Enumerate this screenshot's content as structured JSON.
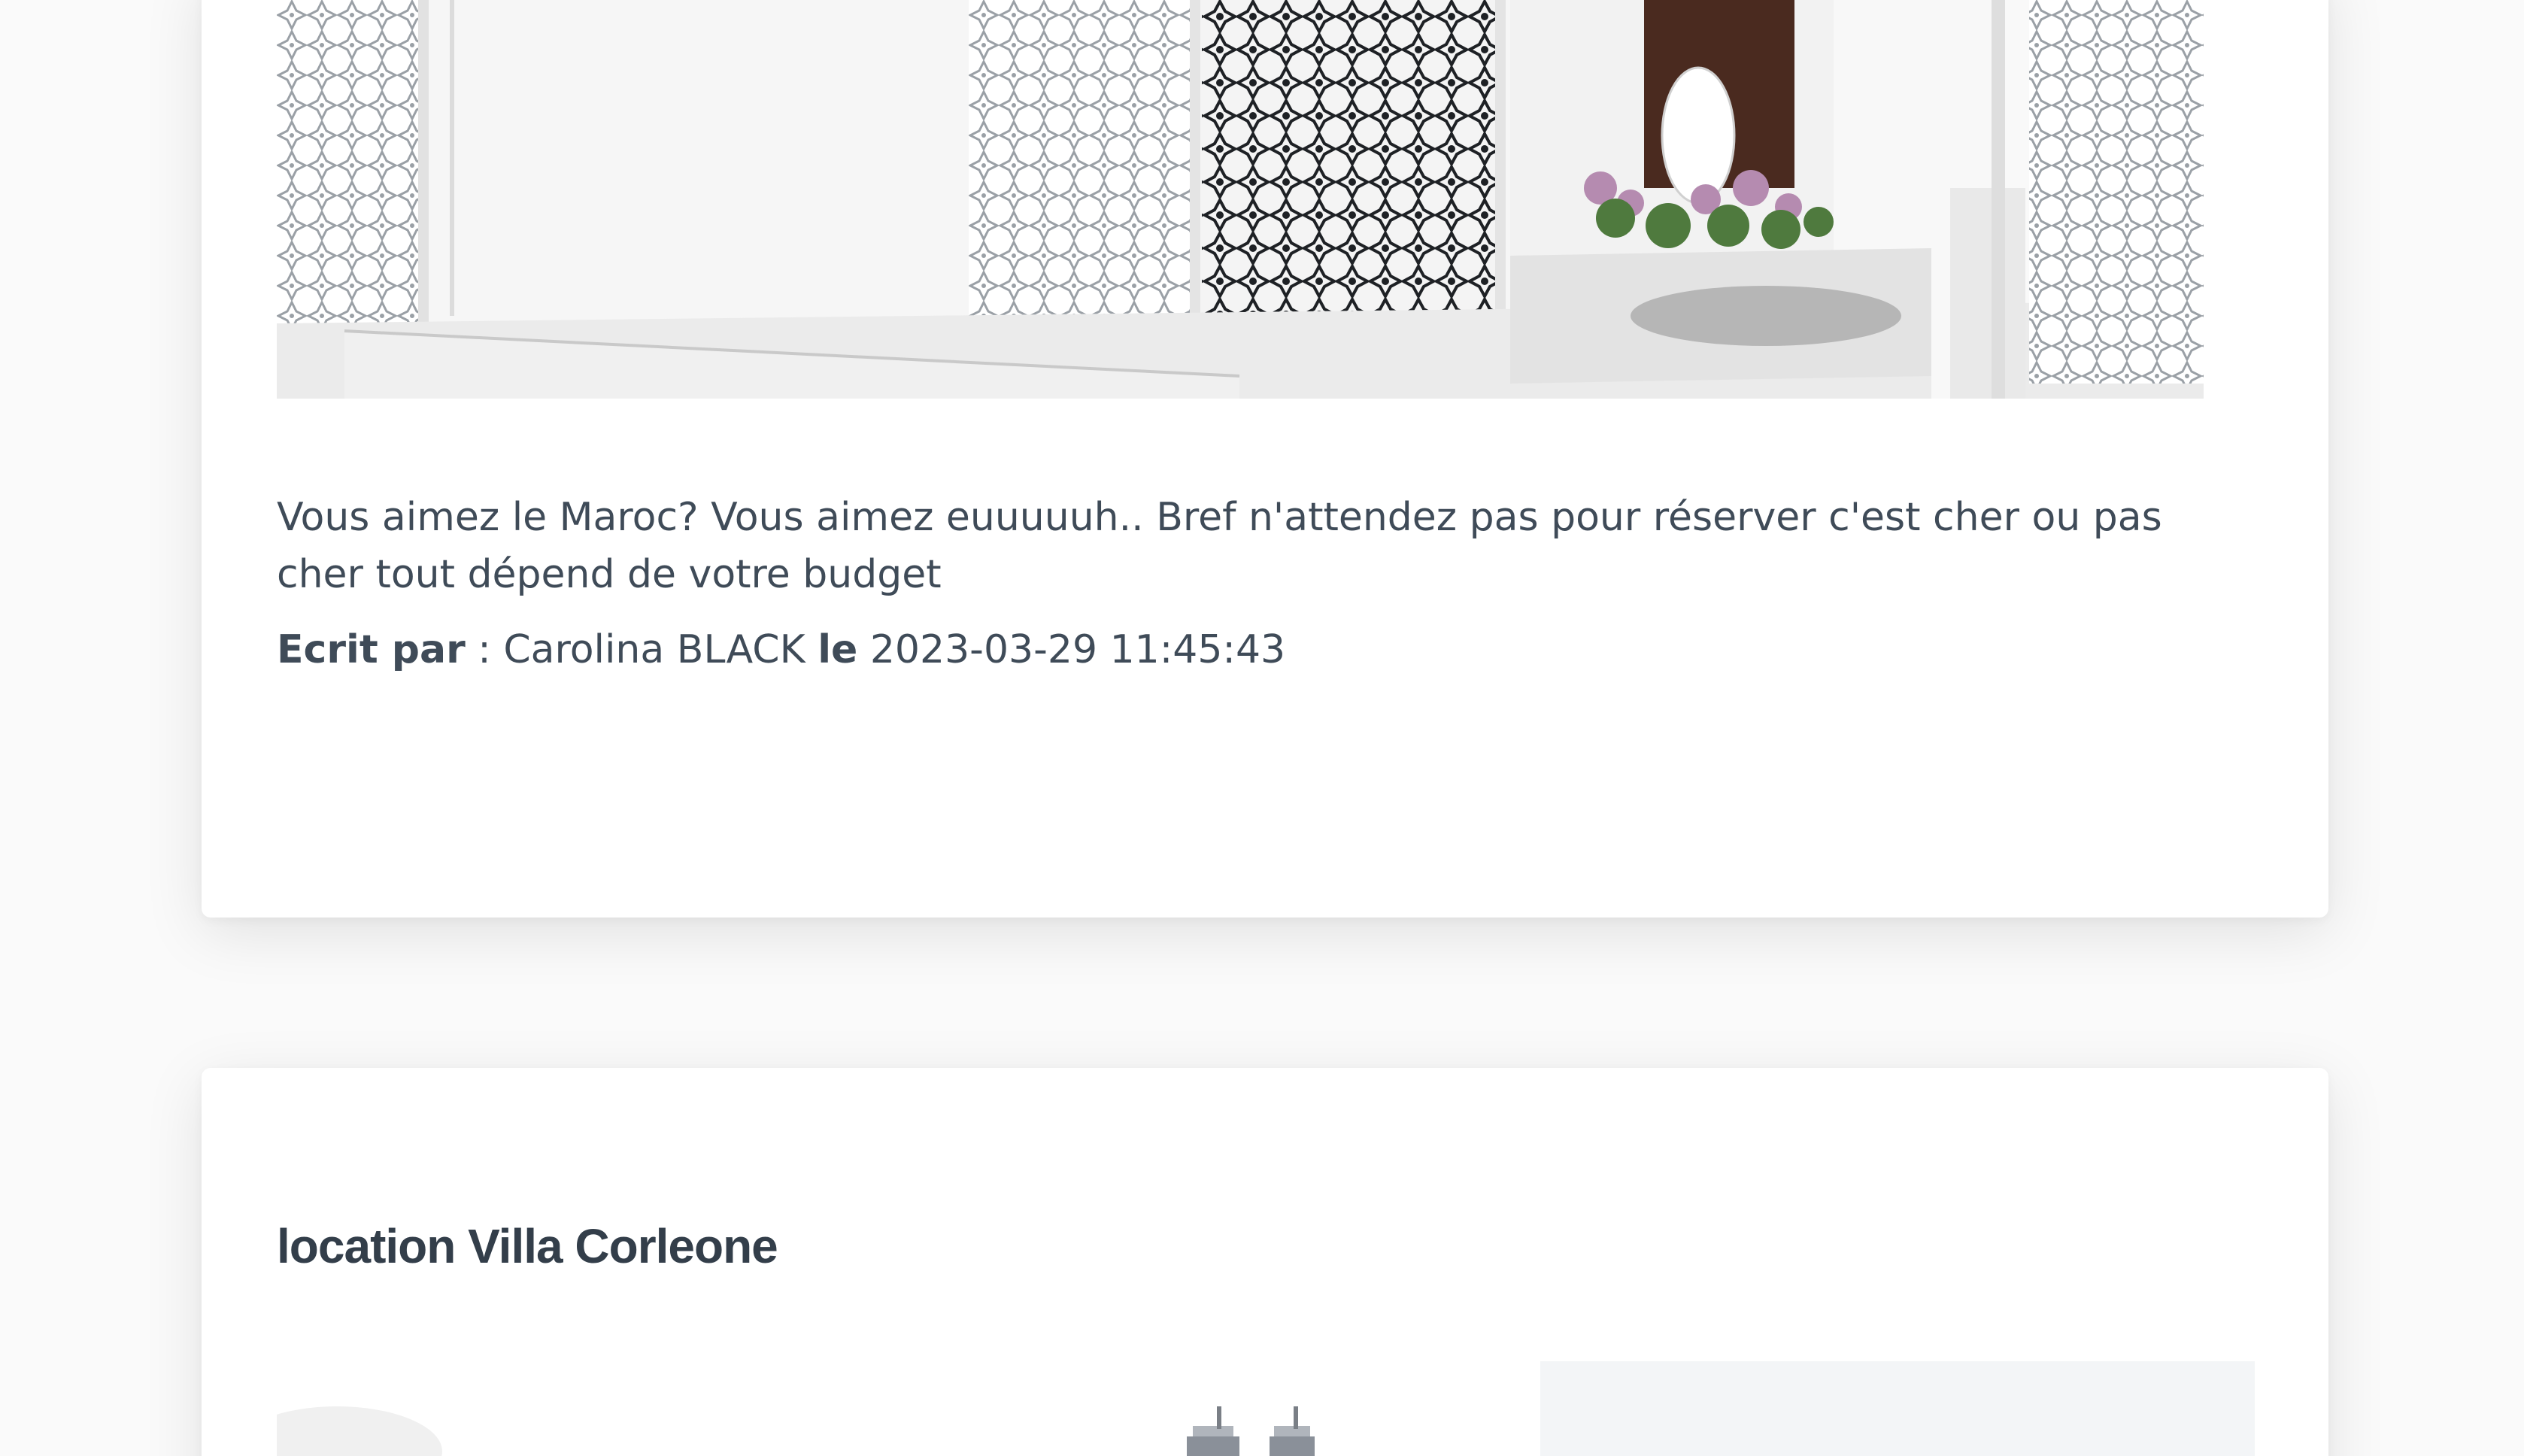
{
  "posts": [
    {
      "image_alt": "white moroccan lattice patio",
      "body": "Vous aimez le Maroc? Vous aimez euuuuuh.. Bref n'attendez pas pour réserver c'est cher ou pas cher tout dépend de votre budget",
      "author_prefix": "Ecrit par",
      "author_sep": " : ",
      "author": "Carolina BLACK",
      "date_prefix": "le",
      "date": "2023-03-29 11:45:43"
    },
    {
      "title": "location Villa Corleone",
      "image_alt": "villa exterior"
    }
  ]
}
